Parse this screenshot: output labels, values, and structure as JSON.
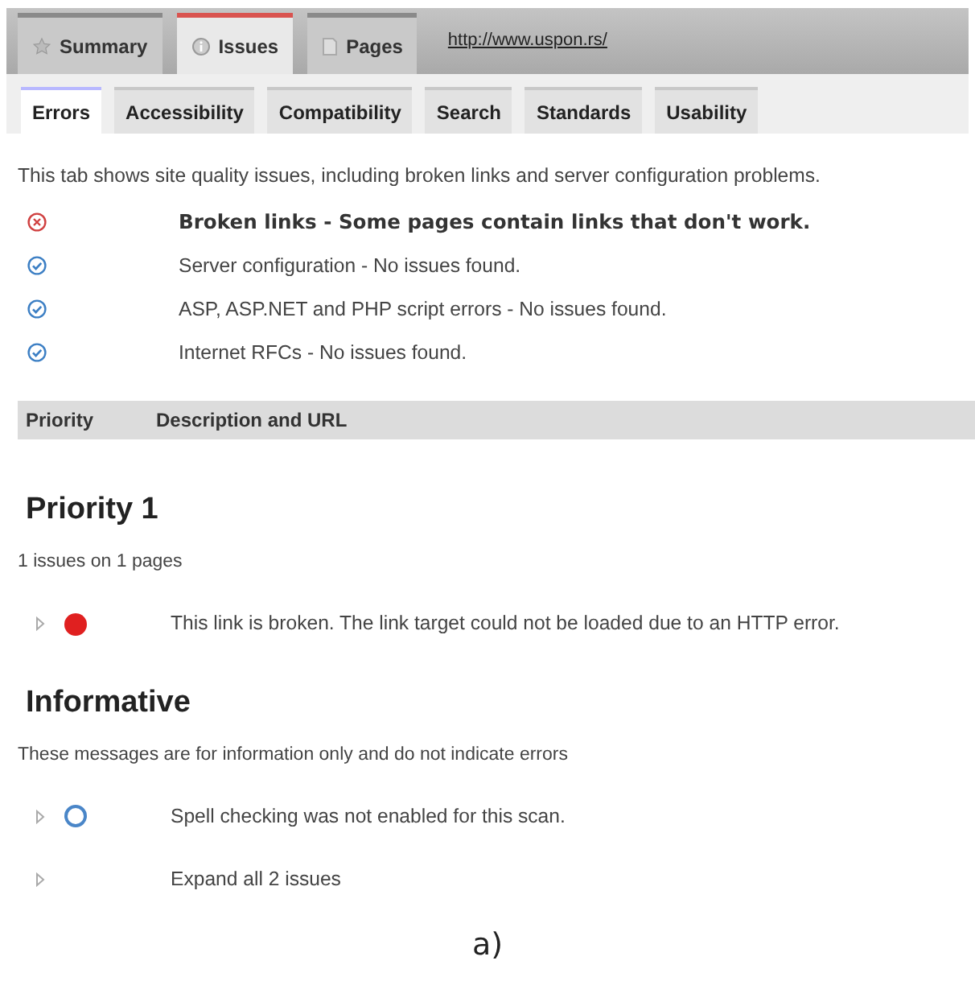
{
  "top_tabs": [
    {
      "label": "Summary",
      "kind": "star",
      "selected": false
    },
    {
      "label": "Issues",
      "kind": "info",
      "selected": true
    },
    {
      "label": "Pages",
      "kind": "page",
      "selected": false
    }
  ],
  "url": "http://www.uspon.rs/",
  "sub_tabs": [
    {
      "label": "Errors",
      "selected": true
    },
    {
      "label": "Accessibility",
      "selected": false
    },
    {
      "label": "Compatibility",
      "selected": false
    },
    {
      "label": "Search",
      "selected": false
    },
    {
      "label": "Standards",
      "selected": false
    },
    {
      "label": "Usability",
      "selected": false
    }
  ],
  "intro": "This tab shows site quality issues, including broken links and server configuration problems.",
  "checks": [
    {
      "kind": "error",
      "text": "Broken links - Some pages contain links that don't work."
    },
    {
      "kind": "ok",
      "text": "Server configuration - No issues found."
    },
    {
      "kind": "ok",
      "text": "ASP, ASP.NET and PHP script errors - No issues found."
    },
    {
      "kind": "ok",
      "text": "Internet RFCs - No issues found."
    }
  ],
  "table_header": [
    "Priority",
    "Description and URL"
  ],
  "sections": [
    {
      "title": "Priority 1",
      "subtitle": "1 issues on 1 pages",
      "rows": [
        {
          "kind": "error",
          "text": "This link is broken. The link target could not be loaded due to an HTTP error."
        }
      ]
    },
    {
      "title": "Informative",
      "subtitle": "These messages are for information only and do not indicate errors",
      "rows": [
        {
          "kind": "info",
          "text": "Spell checking was not enabled for this scan."
        },
        {
          "kind": "expand",
          "text": "Expand all 2 issues"
        }
      ]
    }
  ],
  "caption": "a)"
}
